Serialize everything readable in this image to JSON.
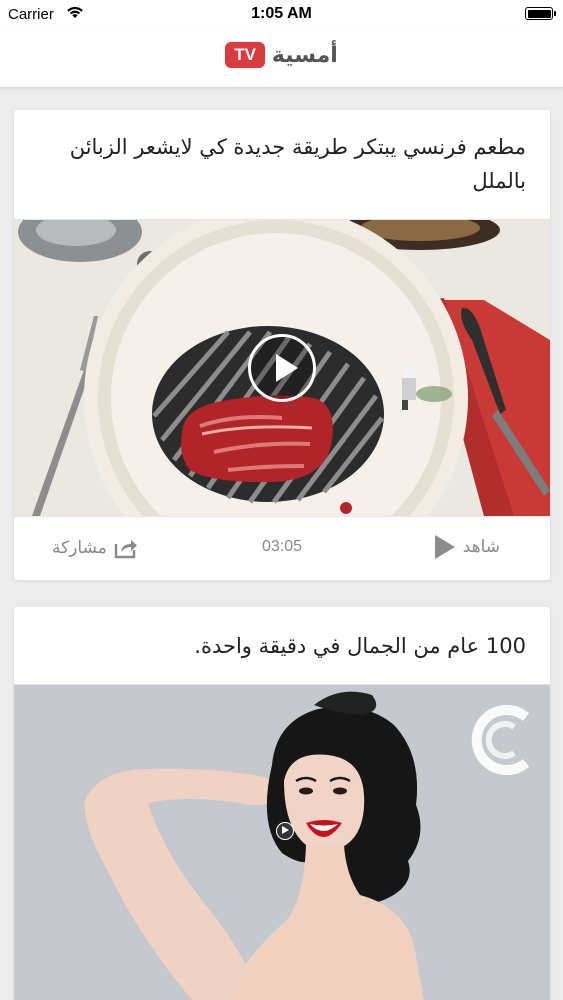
{
  "status_bar": {
    "carrier": "Carrier",
    "time": "1:05 AM",
    "wifi_icon": "wifi-icon",
    "battery_icon": "battery-icon",
    "battery_level": 1.0
  },
  "header": {
    "logo_badge": "TV",
    "logo_name": "أمسية",
    "badge_color": "#d93b3f"
  },
  "feed": {
    "items": [
      {
        "title": "مطعم فرنسي يبتكر طريقة جديدة كي لايشعر الزبائن بالملل",
        "media_icon": "play-icon",
        "actions": {
          "share_label": "مشاركة",
          "share_icon": "share-icon",
          "duration": "03:05",
          "watch_label": "شاهد",
          "watch_icon": "play-icon"
        }
      },
      {
        "title": "100 عام من الجمال في دقيقة واحدة.",
        "media_icon": "play-icon"
      }
    ]
  }
}
